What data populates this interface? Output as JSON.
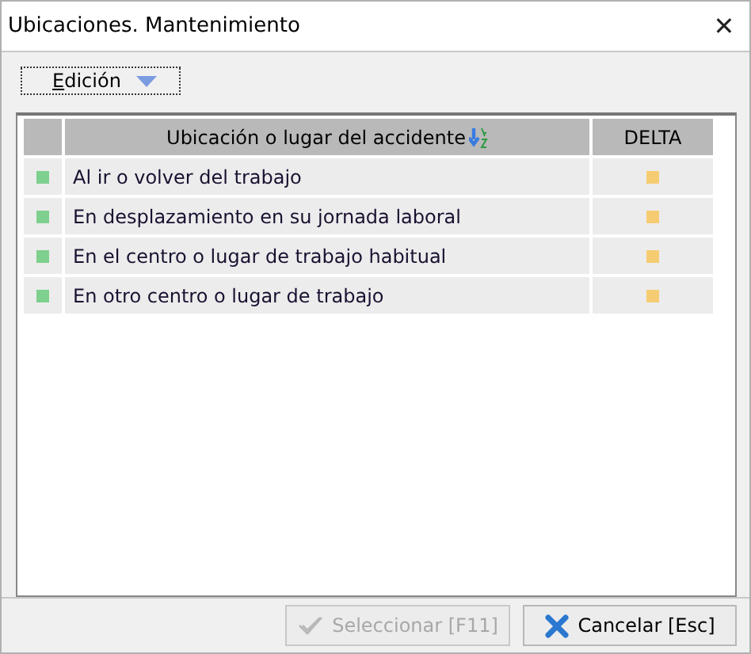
{
  "window": {
    "title": "Ubicaciones. Mantenimiento",
    "close": "✕"
  },
  "toolbar": {
    "menu": "Edición"
  },
  "table": {
    "columns": [
      "Ubicación o lugar del accidente",
      "DELTA"
    ],
    "rows": [
      {
        "text": "Al ir o volver del trabajo"
      },
      {
        "text": "En desplazamiento en su jornada laboral"
      },
      {
        "text": "En el centro o lugar de trabajo habitual"
      },
      {
        "text": "En otro centro o lugar de trabajo"
      }
    ]
  },
  "buttons": [
    {
      "label": "Seleccionar [F11]",
      "kind": "select",
      "disabled": true
    },
    {
      "label": "Cancelar [Esc]",
      "kind": "cancel",
      "disabled": false
    }
  ]
}
